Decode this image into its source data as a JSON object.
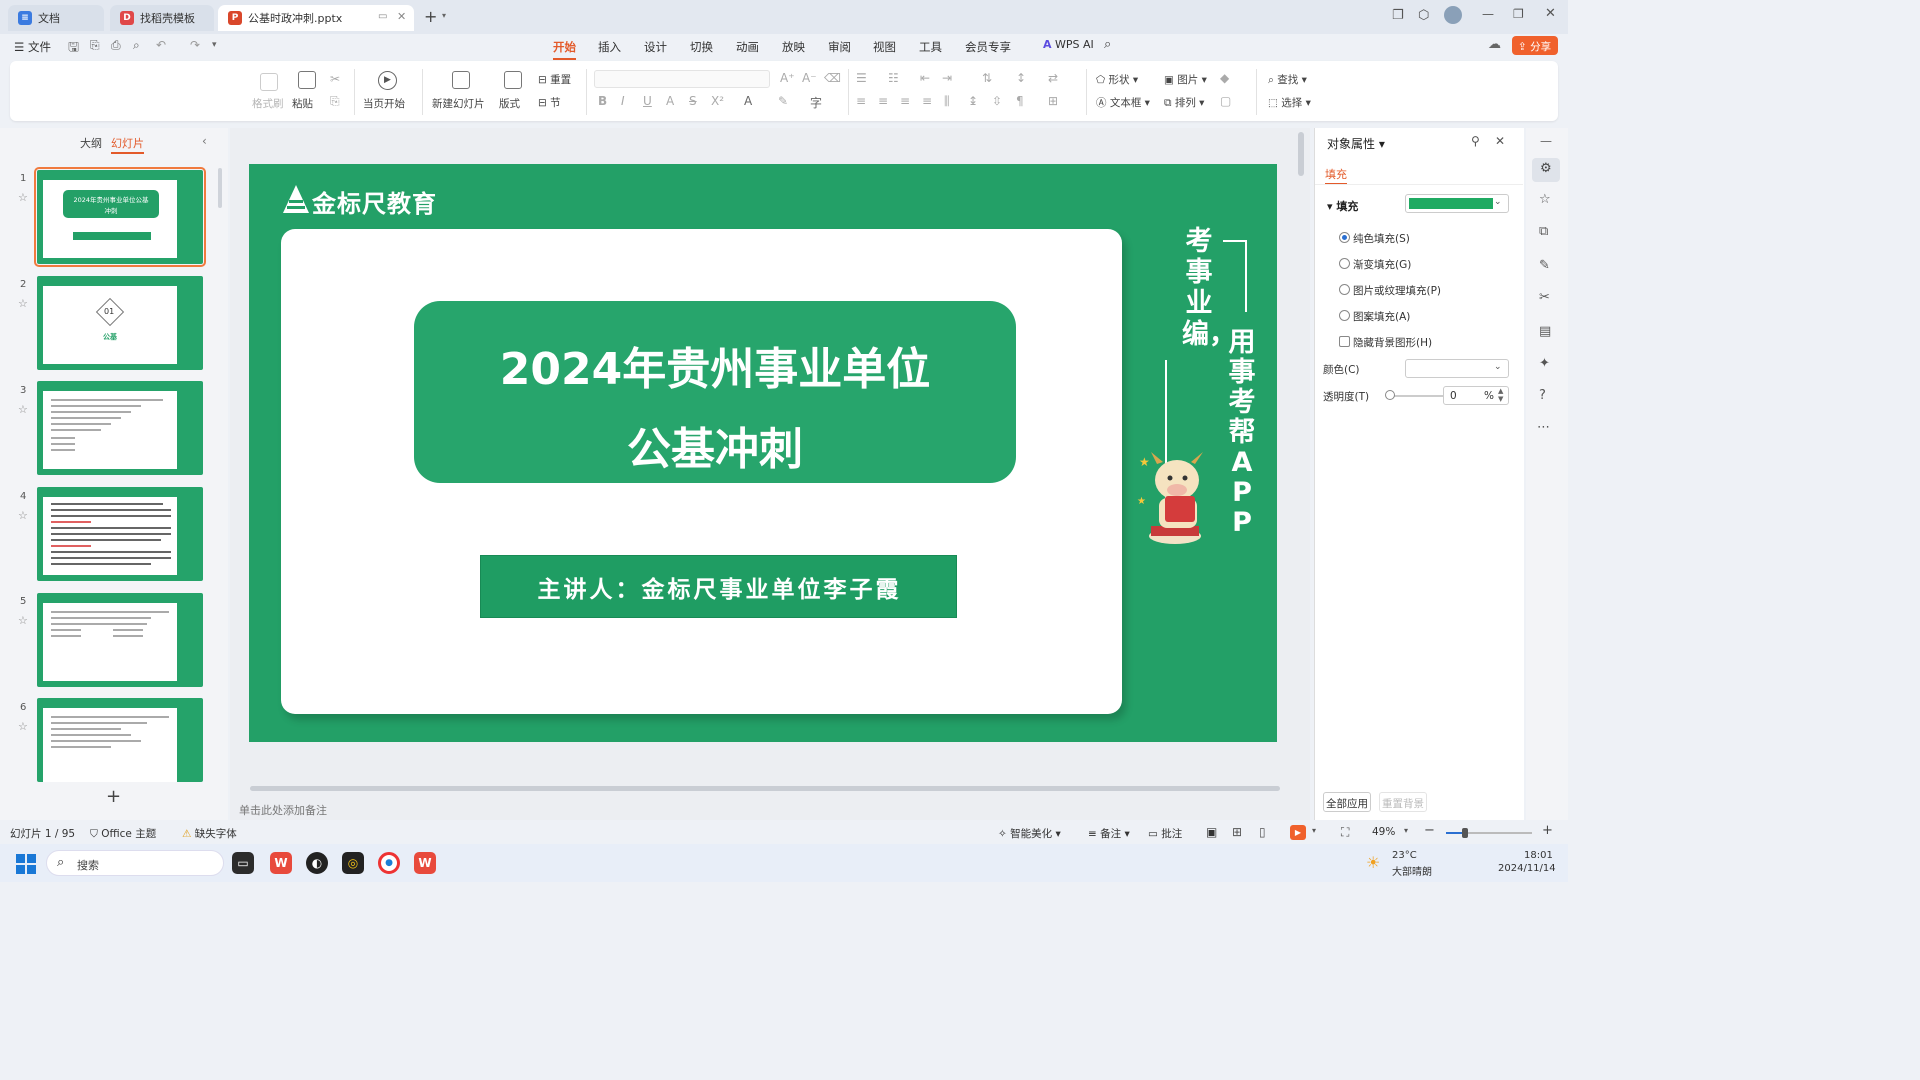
{
  "tabs": [
    {
      "label": "文档",
      "icon": "doc-icon"
    },
    {
      "label": "找稻壳模板",
      "icon": "docer-icon"
    },
    {
      "label": "公基时政冲刺.pptx",
      "icon": "pptx-icon"
    }
  ],
  "menu": {
    "file": "文件",
    "items": [
      "开始",
      "插入",
      "设计",
      "切换",
      "动画",
      "放映",
      "审阅",
      "视图",
      "工具",
      "会员专享"
    ],
    "wps_ai": "WPS AI",
    "share": "分享"
  },
  "ribbon": {
    "format_painter": "格式刷",
    "paste": "粘贴",
    "start_from_current": "当页开始",
    "new_slide": "新建幻灯片",
    "layout": "版式",
    "reset": "重置",
    "section": "节",
    "shape": "形状",
    "picture": "图片",
    "textbox": "文本框",
    "arrange": "排列",
    "find": "查找",
    "select": "选择"
  },
  "left_panel": {
    "outline_tab": "大纲",
    "slides_tab": "幻灯片",
    "thumbnails": [
      {
        "num": "1",
        "title": "2024年贵州事业单位公基冲刺"
      },
      {
        "num": "2",
        "title": "01",
        "sub": "公基"
      },
      {
        "num": "3",
        "title": ""
      },
      {
        "num": "4",
        "title": ""
      },
      {
        "num": "5",
        "title": ""
      },
      {
        "num": "6",
        "title": ""
      }
    ]
  },
  "slide": {
    "logo": "金标尺教育",
    "title_line1": "2024年贵州事业单位",
    "title_line2": "公基冲刺",
    "presenter": "主讲人：金标尺事业单位李子霞",
    "vertical_left": "考事业编，",
    "vertical_right": "用事考帮APP",
    "colors": {
      "green": "#23a067",
      "white": "#ffffff"
    }
  },
  "notes_placeholder": "单击此处添加备注",
  "right_panel": {
    "title": "对象属性",
    "tab_fill": "填充",
    "fill_section": "填充",
    "fill_color": "#1faa62",
    "options": [
      "纯色填充(S)",
      "渐变填充(G)",
      "图片或纹理填充(P)",
      "图案填充(A)"
    ],
    "hide_bg": "隐藏背景图形(H)",
    "color_label": "颜色(C)",
    "transparency_label": "透明度(T)",
    "transparency_value": "0",
    "percent": "%",
    "apply_all": "全部应用",
    "reset_bg": "重置背景"
  },
  "status": {
    "slide_info": "幻灯片 1 / 95",
    "theme": "Office 主题",
    "missing_font": "缺失字体",
    "beautify": "智能美化",
    "notes": "备注",
    "comment": "批注",
    "zoom": "49%"
  },
  "taskbar": {
    "search": "搜索",
    "weather_temp": "23°C",
    "weather_desc": "大部晴朗",
    "time": "18:01",
    "date": "2024/11/14"
  }
}
